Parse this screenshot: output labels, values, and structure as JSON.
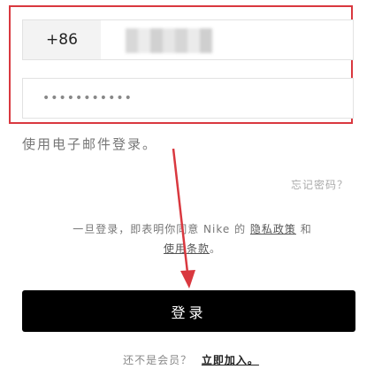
{
  "phone": {
    "country_code": "+86"
  },
  "password": {
    "masked_value": "•••••••••••"
  },
  "email_login_text": "使用电子邮件登录。",
  "forgot_password": "忘记密码？",
  "terms": {
    "prefix": "一旦登录，即表明你同意 Nike 的",
    "privacy_link": "隐私政策",
    "and": "和",
    "terms_link": "使用条款",
    "suffix": "。"
  },
  "login_button": "登录",
  "join": {
    "prefix": "还不是会员？",
    "link": "立即加入。"
  },
  "colors": {
    "highlight": "#d9383f",
    "button": "#000000",
    "arrow": "#d9383f"
  }
}
